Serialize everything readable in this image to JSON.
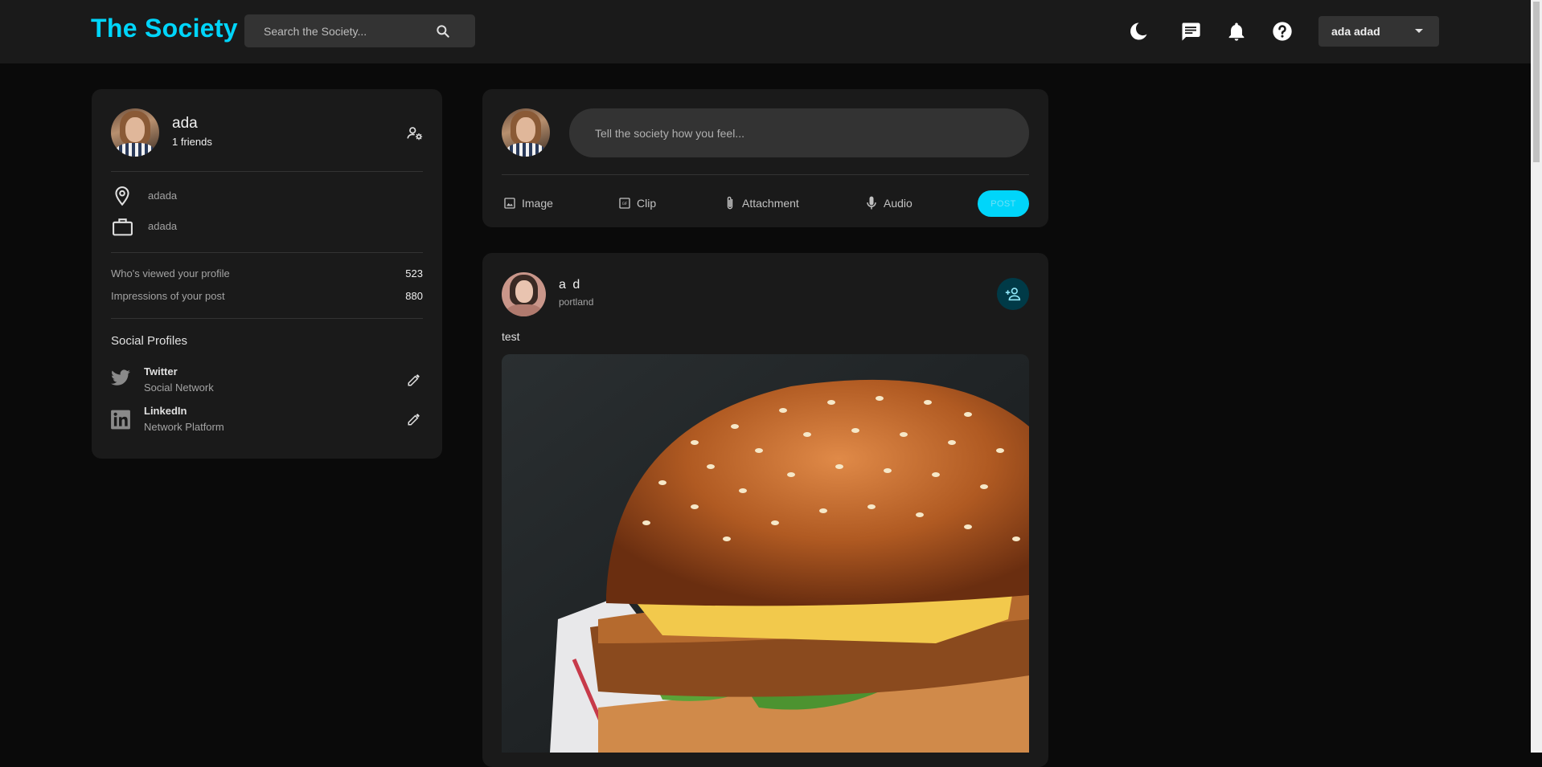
{
  "header": {
    "brand": "The Society",
    "search_placeholder": "Search the Society...",
    "user_name": "ada adad",
    "icons": [
      "dark-mode-icon",
      "message-icon",
      "notification-icon",
      "help-icon"
    ]
  },
  "profile": {
    "name": "ada",
    "friends": "1 friends",
    "location": "adada",
    "occupation": "adada",
    "stats": [
      {
        "label": "Who's viewed your profile",
        "value": "523"
      },
      {
        "label": "Impressions of your post",
        "value": "880"
      }
    ],
    "social_title": "Social Profiles",
    "social": [
      {
        "name": "Twitter",
        "sub": "Social Network"
      },
      {
        "name": "LinkedIn",
        "sub": "Network Platform"
      }
    ]
  },
  "composer": {
    "placeholder": "Tell the society how you feel...",
    "actions": [
      "Image",
      "Clip",
      "Attachment",
      "Audio"
    ],
    "post_label": "POST"
  },
  "post": {
    "author": "a d",
    "location": "portland",
    "text": "test"
  },
  "colors": {
    "accent": "#00d5fa",
    "background": "#0a0a0a",
    "card": "#1a1a1a",
    "input": "#333333"
  }
}
